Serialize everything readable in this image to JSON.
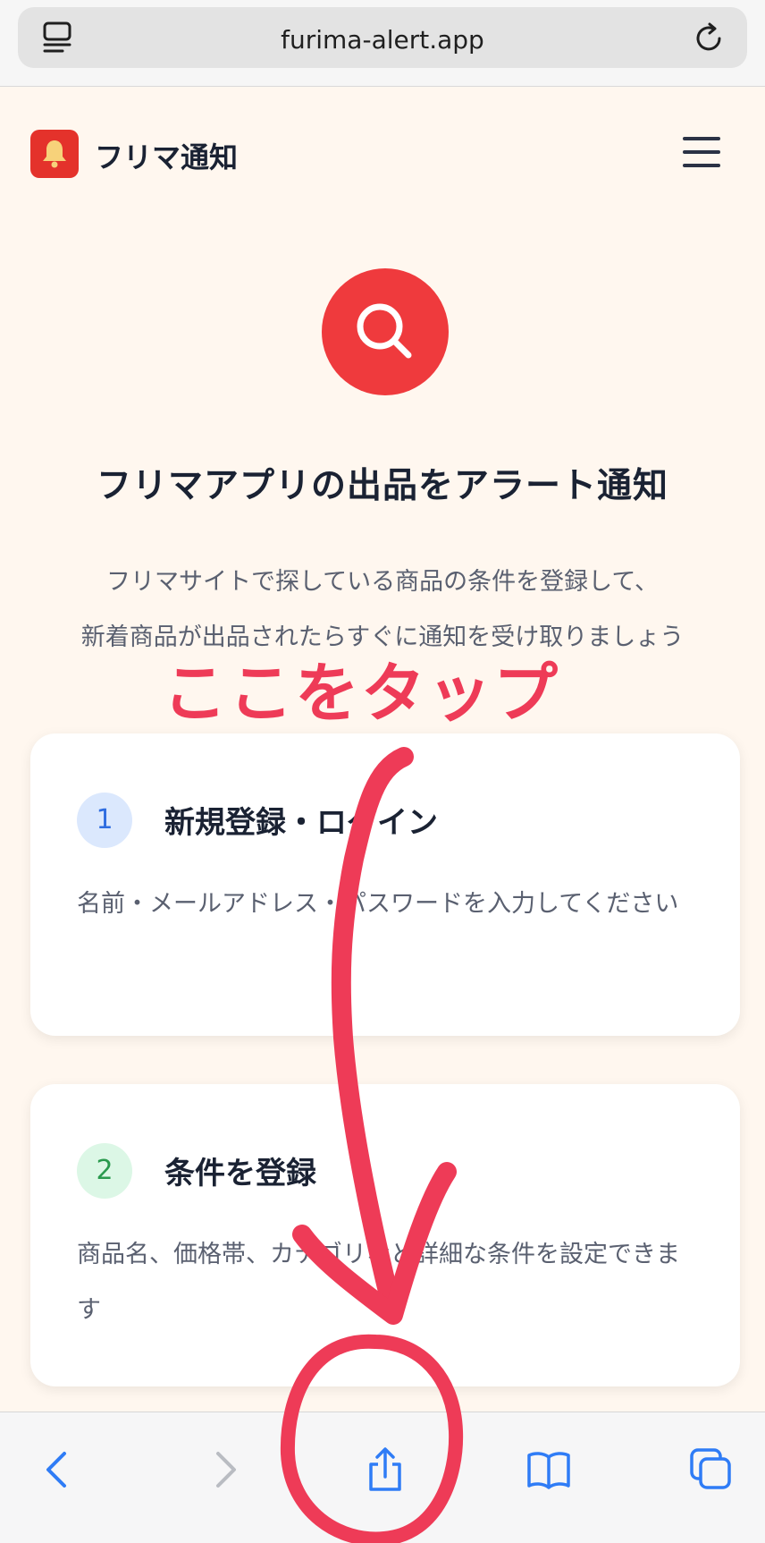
{
  "browser": {
    "url": "furima-alert.app",
    "icons": {
      "tabs": "tab-overview-icon",
      "reload": "reload-icon"
    }
  },
  "header": {
    "brand": "フリマ通知",
    "logo_icon": "bell-icon",
    "menu_icon": "hamburger-menu-icon"
  },
  "hero": {
    "icon": "search-icon",
    "title": "フリマアプリの出品をアラート通知",
    "desc_line1": "フリマサイトで探している商品の条件を登録して、",
    "desc_line2": "新着商品が出品されたらすぐに通知を受け取りましょう"
  },
  "annotation": {
    "text": "ここをタップ",
    "color": "#ee3b57"
  },
  "steps": [
    {
      "number": "1",
      "title": "新規登録・ログイン",
      "desc": "名前・メールアドレス・パスワードを入力してください"
    },
    {
      "number": "2",
      "title": "条件を登録",
      "desc": "商品名、価格帯、カテゴリなど詳細な条件を設定できます"
    }
  ],
  "toolbar": {
    "back_icon": "chevron-left-icon",
    "forward_icon": "chevron-right-icon",
    "share_icon": "share-icon",
    "bookmarks_icon": "book-icon",
    "tabs_icon": "tabs-icon"
  },
  "colors": {
    "accent": "#ef3a3d",
    "toolbar_blue": "#2f7cf6",
    "background": "#fff7ef"
  }
}
